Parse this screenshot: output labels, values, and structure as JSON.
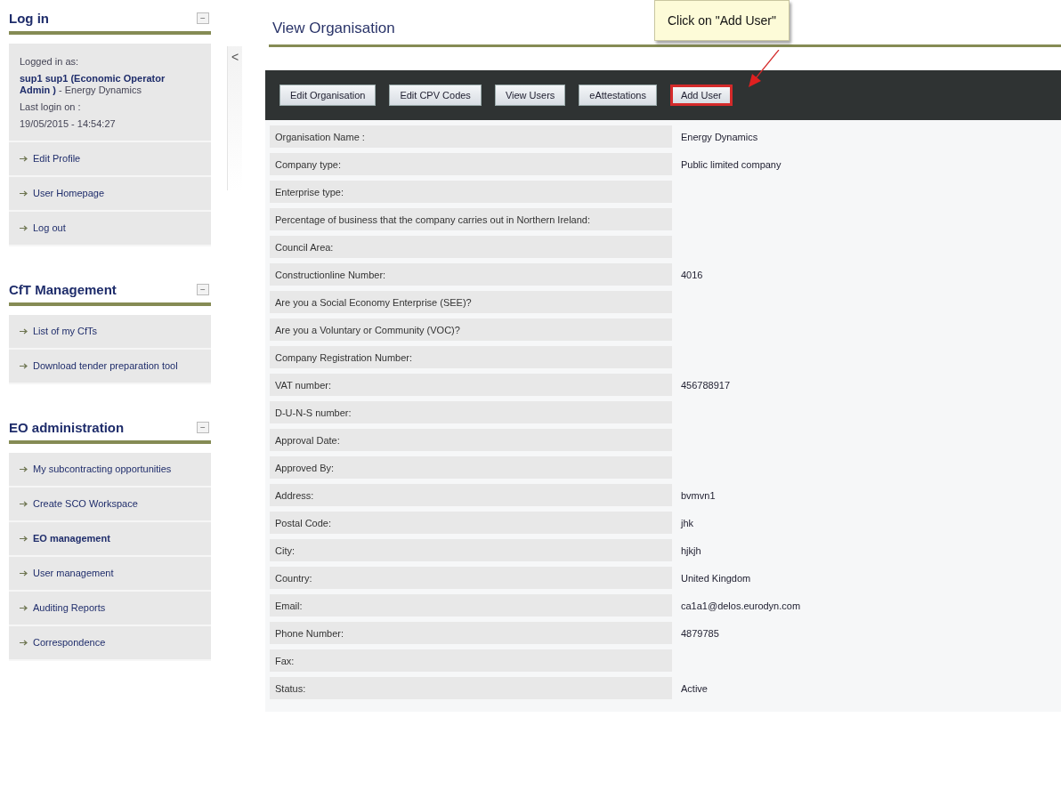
{
  "sidebar": {
    "collapse_handle": {
      "label": "<"
    },
    "sections": [
      {
        "title": "Log in",
        "collapse": "−",
        "info": [
          {
            "text": "Logged in as:"
          },
          {
            "text": "**sup1 sup1 (Economic Operator Admin )** - Energy Dynamics"
          },
          {
            "text": "Last login on :"
          },
          {
            "text": "19/05/2015 - 14:54:27"
          }
        ],
        "items": [
          {
            "label": "Edit Profile",
            "selected": false
          },
          {
            "label": "User Homepage",
            "selected": false
          },
          {
            "label": "Log out",
            "selected": false
          }
        ]
      },
      {
        "title": "CfT Management",
        "collapse": "−",
        "items": [
          {
            "label": "List of my CfTs",
            "selected": false
          },
          {
            "label": "Download tender preparation tool",
            "selected": false
          }
        ]
      },
      {
        "title": "EO administration",
        "collapse": "−",
        "items": [
          {
            "label": "My subcontracting opportunities",
            "selected": false
          },
          {
            "label": "Create SCO Workspace",
            "selected": false
          },
          {
            "label": "EO management",
            "selected": true
          },
          {
            "label": "User management",
            "selected": false
          },
          {
            "label": "Auditing Reports",
            "selected": false
          },
          {
            "label": "Correspondence",
            "selected": false
          }
        ]
      }
    ]
  },
  "page": {
    "title": "View Organisation",
    "toolbar": [
      {
        "label": "Edit Organisation",
        "highlighted": false
      },
      {
        "label": "Edit CPV Codes",
        "highlighted": false
      },
      {
        "label": "View Users",
        "highlighted": false
      },
      {
        "label": "eAttestations",
        "highlighted": false
      },
      {
        "label": "Add User",
        "highlighted": true
      }
    ],
    "callout": {
      "text": "Click on \"Add User\""
    },
    "details": [
      {
        "label": "Organisation Name :",
        "value": "Energy Dynamics"
      },
      {
        "label": "Company type:",
        "value": "Public limited company"
      },
      {
        "label": "Enterprise type:"
      },
      {
        "label": "Percentage of business that the company carries out in Northern Ireland:"
      },
      {
        "label": "Council Area:"
      },
      {
        "label": "Constructionline Number:",
        "value": "4016"
      },
      {
        "label": "Are you a Social Economy Enterprise (SEE)?"
      },
      {
        "label": "Are you a Voluntary or Community (VOC)?"
      },
      {
        "label": "Company Registration Number:"
      },
      {
        "label": "VAT number:",
        "value": "456788917"
      },
      {
        "label": "D-U-N-S number:"
      },
      {
        "label": "Approval Date:"
      },
      {
        "label": "Approved By:"
      },
      {
        "label": "Address:",
        "value": "bvmvn1"
      },
      {
        "label": "Postal Code:",
        "value": "jhk"
      },
      {
        "label": "City:",
        "value": "hjkjh"
      },
      {
        "label": "Country:",
        "value": "United Kingdom"
      },
      {
        "label": "Email:",
        "value": "ca1a1@delos.eurodyn.com"
      },
      {
        "label": "Phone Number:",
        "value": "4879785"
      },
      {
        "label": "Fax:"
      },
      {
        "label": "Status:",
        "value": "Active"
      }
    ]
  }
}
